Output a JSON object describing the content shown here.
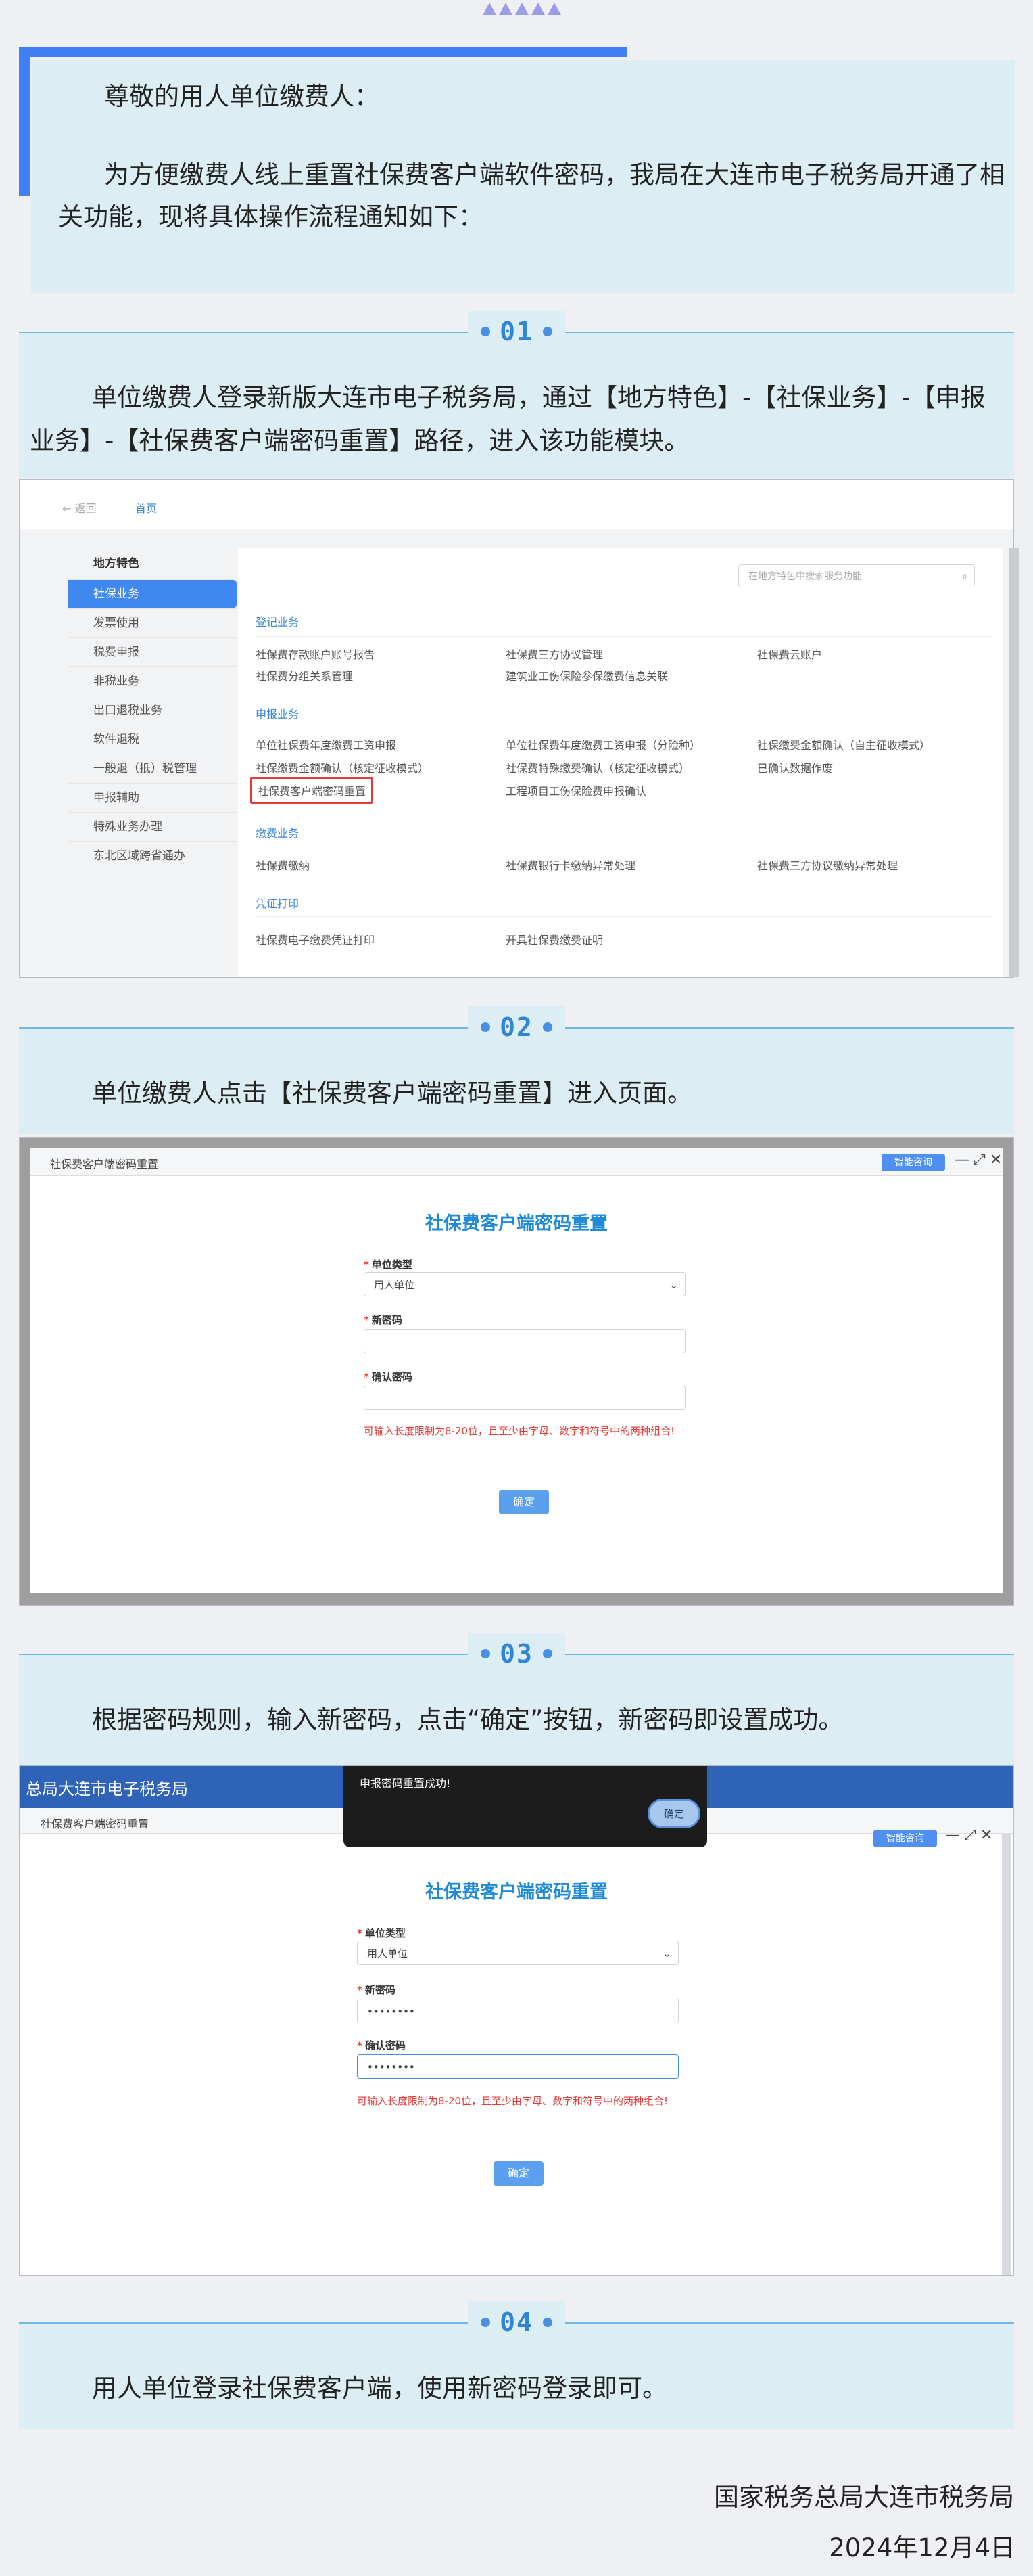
{
  "intro": {
    "salutation": "尊敬的用人单位缴费人：",
    "body": "为方便缴费人线上重置社保费客户端软件密码，我局在大连市电子税务局开通了相关功能，现将具体操作流程通知如下："
  },
  "steps": [
    {
      "num": "01",
      "text": "单位缴费人登录新版大连市电子税务局，通过【地方特色】-【社保业务】-【申报业务】-【社保费客户端密码重置】路径，进入该功能模块。"
    },
    {
      "num": "02",
      "text": "单位缴费人点击【社保费客户端密码重置】进入页面。"
    },
    {
      "num": "03",
      "text": "根据密码规则，输入新密码，点击“确定”按钮，新密码即设置成功。"
    },
    {
      "num": "04",
      "text": "用人单位登录社保费客户端，使用新密码登录即可。"
    }
  ],
  "shot1": {
    "back": "← 返回",
    "home": "首页",
    "sidebar_title": "地方特色",
    "sidebar_items": [
      "社保业务",
      "发票使用",
      "税费申报",
      "非税业务",
      "出口退税业务",
      "软件退税",
      "一般退（抵）税管理",
      "申报辅助",
      "特殊业务办理",
      "东北区域跨省通办"
    ],
    "search_placeholder": "在地方特色中搜索服务功能",
    "sections": [
      {
        "title": "登记业务",
        "rows": [
          [
            "社保费存款账户账号报告",
            "社保费三方协议管理",
            "社保费云账户"
          ],
          [
            "社保费分组关系管理",
            "建筑业工伤保险参保缴费信息关联",
            ""
          ]
        ]
      },
      {
        "title": "申报业务",
        "rows": [
          [
            "单位社保费年度缴费工资申报",
            "单位社保费年度缴费工资申报（分险种）",
            "社保缴费金额确认（自主征收模式）"
          ],
          [
            "社保缴费金额确认（核定征收模式）",
            "社保费特殊缴费确认（核定征收模式）",
            "已确认数据作废"
          ],
          [
            "社保费客户端密码重置",
            "工程项目工伤保险费申报确认",
            ""
          ]
        ]
      },
      {
        "title": "缴费业务",
        "rows": [
          [
            "社保费缴纳",
            "社保费银行卡缴纳异常处理",
            "社保费三方协议缴纳异常处理"
          ]
        ]
      },
      {
        "title": "凭证打印",
        "rows": [
          [
            "社保费电子缴费凭证打印",
            "开具社保费缴费证明",
            ""
          ]
        ]
      }
    ]
  },
  "form": {
    "window_title": "社保费客户端密码重置",
    "guide_button": "智能咨询",
    "title": "社保费客户端密码重置",
    "unit_type_label": "单位类型",
    "unit_type_value": "用人单位",
    "new_pwd_label": "新密码",
    "confirm_pwd_label": "确认密码",
    "hint": "可输入长度限制为8-20位，且至少由字母、数字和符号中的两种组合!",
    "ok": "确定",
    "masked": "••••••••"
  },
  "shot3": {
    "app_title": "总局大连市电子税务局",
    "toast_text": "申报密码重置成功!",
    "toast_ok": "确定"
  },
  "footer": {
    "org": "国家税务总局大连市税务局",
    "date": "2024年12月4日"
  }
}
